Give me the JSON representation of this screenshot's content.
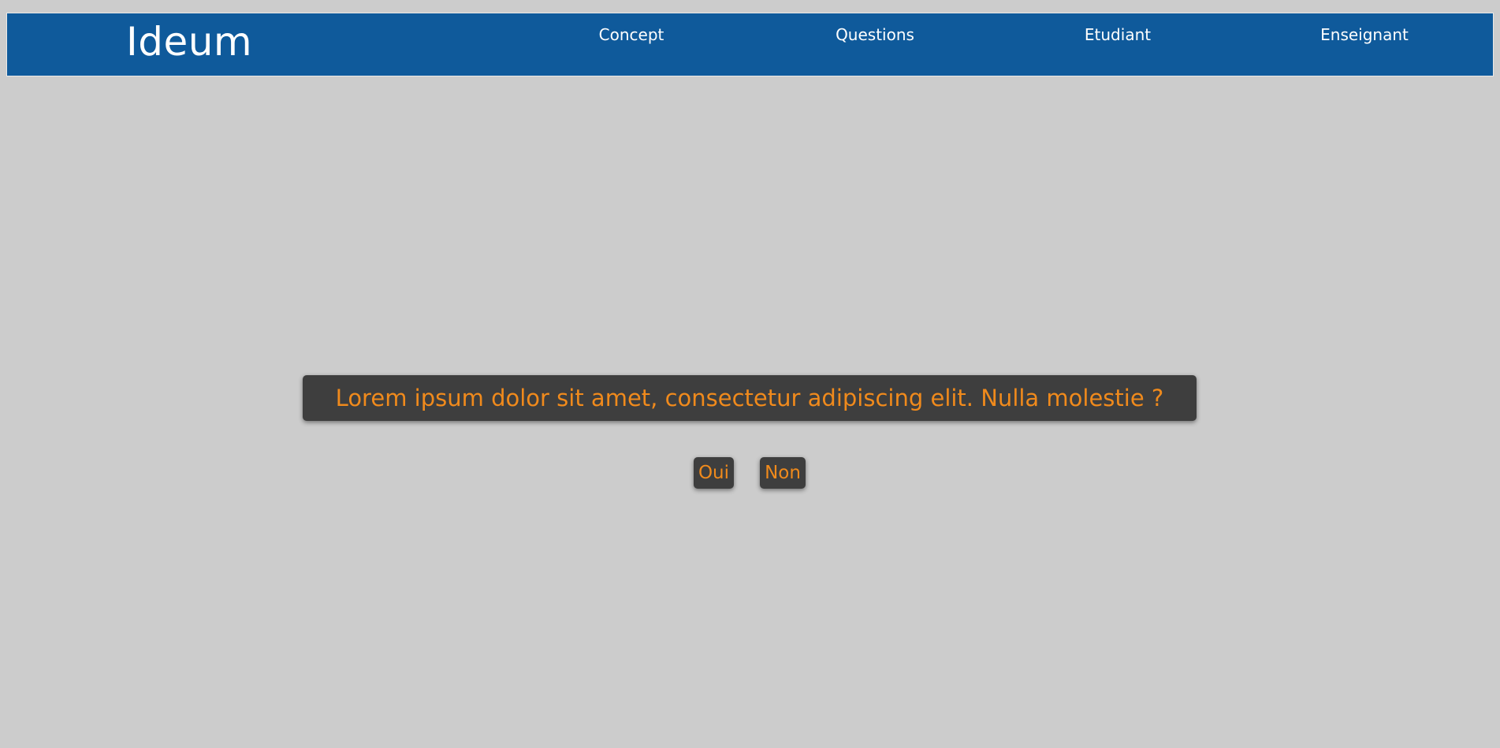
{
  "header": {
    "brand": "Ideum",
    "nav": {
      "concept": "Concept",
      "questions": "Questions",
      "etudiant": "Etudiant",
      "enseignant": "Enseignant"
    }
  },
  "question": {
    "text": "Lorem ipsum dolor sit amet, consectetur adipiscing elit. Nulla molestie ?"
  },
  "answers": {
    "yes": "Oui",
    "no": "Non"
  },
  "colors": {
    "header_bg": "#0f5a9b",
    "page_bg": "#cccccc",
    "box_bg": "#3e3e3e",
    "accent_text": "#f08a1c"
  }
}
